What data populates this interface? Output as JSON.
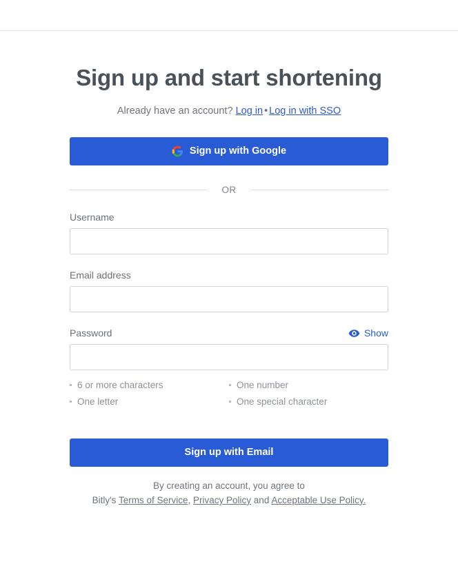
{
  "header": {
    "bar_label": "top-navigation-bar"
  },
  "main": {
    "heading": "Sign up and start shortening",
    "account_prompt": "Already have an account?",
    "login_link": "Log in",
    "separator_dot": "•",
    "sso_link": "Log in with SSO",
    "google_button": "Sign up with Google",
    "google_icon_name": "google-g-icon",
    "divider_label": "OR",
    "email_button": "Sign up with Email"
  },
  "form": {
    "username": {
      "label": "Username",
      "value": "",
      "placeholder": ""
    },
    "email": {
      "label": "Email address",
      "value": "",
      "placeholder": ""
    },
    "password": {
      "label": "Password",
      "value": "",
      "placeholder": "",
      "show_label": "Show",
      "eye_icon_name": "eye-icon"
    },
    "password_hints": [
      "6 or more characters",
      "One number",
      "One letter",
      "One special character"
    ]
  },
  "legal": {
    "line1": "By creating an account, you agree to",
    "prefix": "Bitly's",
    "terms_link": "Terms of Service",
    "comma": ",",
    "privacy_link": "Privacy Policy",
    "and": "and",
    "acceptable_link": "Acceptable Use Policy."
  },
  "colors": {
    "accent_blue": "#2a5bd7",
    "heading_gray": "#4b5159",
    "label_gray": "#6b7178",
    "hint_gray": "#8d9299",
    "border_gray": "#d2d3d6",
    "divider_gray": "#dcdcdf",
    "google_red": "#ea4335",
    "google_yellow": "#fbbc05",
    "google_green": "#34a853",
    "google_blue": "#4285f4"
  }
}
